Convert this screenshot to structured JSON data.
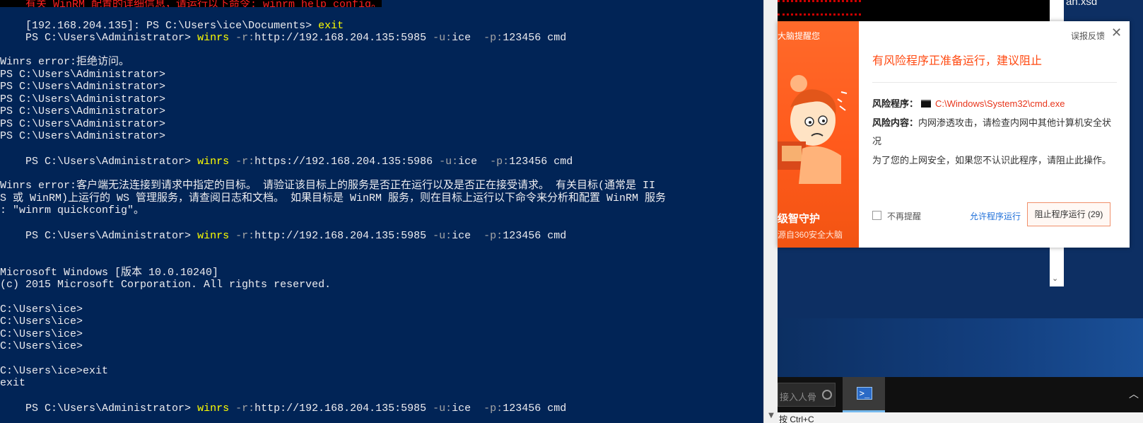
{
  "console": {
    "lines": [
      {
        "text": "有关 WinRM 配置的详细信息，请运行以下命令: winrm help config。"
      },
      {
        "prompt": "[192.168.204.135]: PS C:\\Users\\ice\\Documents> ",
        "cmd": "exit"
      },
      {
        "prompt": "PS C:\\Users\\Administrator> ",
        "cmd": "winrs",
        "f1": " -r:",
        "v1": "http://192.168.204.135:5985",
        "f2": " -u:",
        "v2": "ice  ",
        "f3": "-p:",
        "v3": "123456 cmd"
      },
      {
        "text": "Winrs error:拒绝访问。"
      },
      {
        "text": "PS C:\\Users\\Administrator>"
      },
      {
        "text": "PS C:\\Users\\Administrator>"
      },
      {
        "text": "PS C:\\Users\\Administrator>"
      },
      {
        "text": "PS C:\\Users\\Administrator>"
      },
      {
        "text": "PS C:\\Users\\Administrator>"
      },
      {
        "text": "PS C:\\Users\\Administrator>"
      },
      {
        "prompt": "PS C:\\Users\\Administrator> ",
        "cmd": "winrs",
        "f1": " -r:",
        "v1": "https://192.168.204.135:5986",
        "f2": " -u:",
        "v2": "ice  ",
        "f3": "-p:",
        "v3": "123456 cmd"
      },
      {
        "text": "Winrs error:客户端无法连接到请求中指定的目标。 请验证该目标上的服务是否正在运行以及是否正在接受请求。 有关目标(通常是 II"
      },
      {
        "text": "S 或 WinRM)上运行的 WS 管理服务，请查阅日志和文档。 如果目标是 WinRM 服务，则在目标上运行以下命令来分析和配置 WinRM 服务"
      },
      {
        "text": ": \"winrm quickconfig\"。"
      },
      {
        "prompt": "PS C:\\Users\\Administrator> ",
        "cmd": "winrs",
        "f1": " -r:",
        "v1": "http://192.168.204.135:5985",
        "f2": " -u:",
        "v2": "ice  ",
        "f3": "-p:",
        "v3": "123456 cmd"
      },
      {
        "text": "Microsoft Windows [版本 10.0.10240]"
      },
      {
        "text": "(c) 2015 Microsoft Corporation. All rights reserved."
      },
      {
        "text": "C:\\Users\\ice>"
      },
      {
        "text": "C:\\Users\\ice>"
      },
      {
        "text": "C:\\Users\\ice>"
      },
      {
        "text": "C:\\Users\\ice>"
      },
      {
        "text": "C:\\Users\\ice>exit"
      },
      {
        "text": "exit"
      },
      {
        "prompt": "PS C:\\Users\\Administrator> ",
        "cmd": "winrs",
        "f1": " -r:",
        "v1": "http://192.168.204.135:5985",
        "f2": " -u:",
        "v2": "ice  ",
        "f3": "-p:",
        "v3": "123456 cmd"
      }
    ]
  },
  "background": {
    "filename_fragment": "an.xsd",
    "search_placeholder": "接入人骨",
    "bottom_hint": "按 Ctrl+C"
  },
  "popup": {
    "left_top": "大脑提醒您",
    "left_title": "级智守护",
    "left_sub": "源自360安全大脑",
    "feedback": "误报反馈",
    "close": "✕",
    "warn_title": "有风险程序正准备运行，建议阻止",
    "risk_program_label": "风险程序：",
    "risk_program_value": "C:\\Windows\\System32\\cmd.exe",
    "risk_content_label": "风险内容：",
    "risk_content_value_1": "内网渗透攻击，请检查内网中其他计算机安全状",
    "risk_content_value_2": "况",
    "advice": "为了您的上网安全，如果您不认识此程序，请阻止此操作。",
    "no_remind": "不再提醒",
    "allow": "允许程序运行",
    "block": "阻止程序运行 (29)"
  },
  "colors": {
    "console_bg": "#012456",
    "command": "#ffff00",
    "param": "#a6a6a6",
    "text": "#eeedf0",
    "popup_accent": "#ff4a12"
  }
}
